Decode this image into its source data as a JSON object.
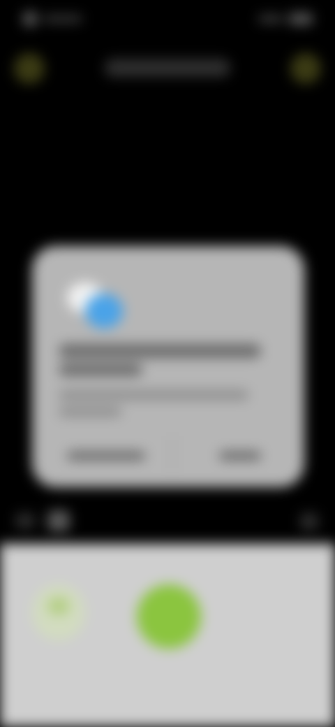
{
  "status_bar": {
    "left_icon": "status-indicator-icon",
    "right_icons": [
      "signal-icon",
      "battery-icon"
    ]
  },
  "top_bar": {
    "title": "",
    "left_icon": "back-icon",
    "right_icon": "options-icon"
  },
  "dialog": {
    "badge_icon": "app-badge-icon",
    "title": "",
    "message": "",
    "buttons": [
      {
        "label": ""
      },
      {
        "label": ""
      }
    ]
  },
  "toolbar": {
    "icons": [
      "toolbar-icon-a",
      "toolbar-icon-b",
      "toolbar-icon-c"
    ]
  },
  "bottom_panel": {
    "secondary_button_icon": "secondary-action-icon",
    "primary_button_icon": "primary-action-icon"
  },
  "colors": {
    "accent_green": "#8bc53f",
    "badge_blue": "#4aa3e8",
    "dialog_bg": "#b6b6b6",
    "panel_bg": "#cfcfcf",
    "background": "#000000"
  }
}
